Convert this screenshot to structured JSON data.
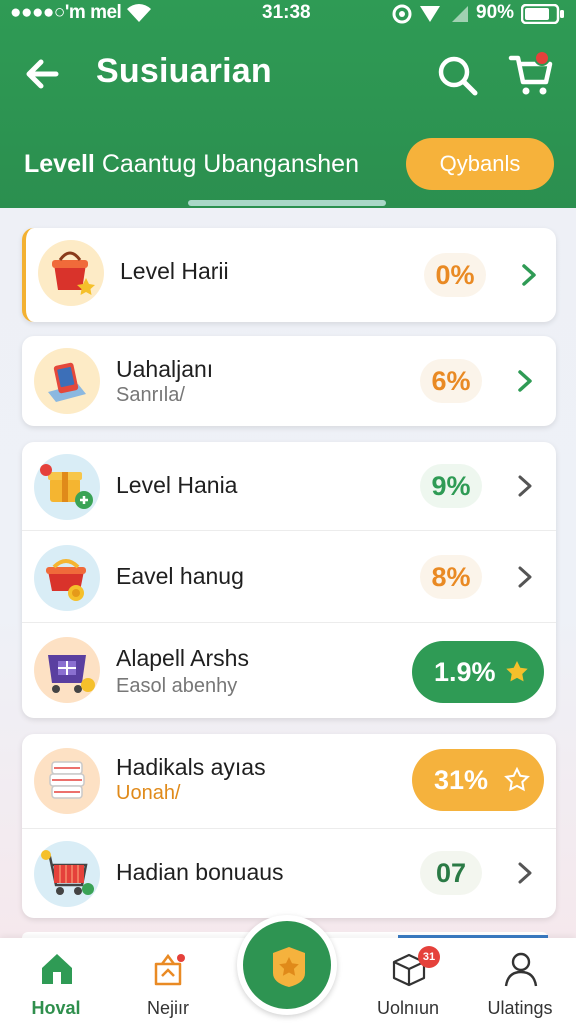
{
  "status_bar": {
    "carrier": "●●●●○'m mel",
    "time": "31:38",
    "battery": "90%"
  },
  "header": {
    "title": "Susiuarian",
    "subtitle_bold": "Levell",
    "subtitle_rest": "Caantug Ubanganshen",
    "action_button": "Qybanls"
  },
  "colors": {
    "brand_green": "#2f9b55",
    "accent_amber": "#f5b23d",
    "badge_orange": "#e98a24",
    "notification_red": "#e5413b"
  },
  "cards": [
    {
      "rows": [
        {
          "icon": "gift-basket-star-icon",
          "title": "Level Harii",
          "subtitle": "",
          "badge": "0%",
          "badge_style": "orange"
        }
      ]
    },
    {
      "rows": [
        {
          "icon": "tablet-book-icon",
          "title": "Uahaljanı",
          "subtitle": "Sanrıla/",
          "badge": "6%",
          "badge_style": "orange"
        }
      ]
    },
    {
      "rows": [
        {
          "icon": "gift-box-coin-icon",
          "title": "Level Hania",
          "subtitle": "",
          "badge": "9%",
          "badge_style": "green"
        },
        {
          "icon": "red-basket-coin-icon",
          "title": "Eavel hanug",
          "subtitle": "",
          "badge": "8%",
          "badge_style": "orange"
        },
        {
          "icon": "purple-gift-cart-icon",
          "title": "Alapell Arshs",
          "subtitle": "Easol abenhy",
          "badge": "1.9%",
          "badge_style": "green-pill"
        }
      ]
    },
    {
      "rows": [
        {
          "icon": "stacked-boxes-icon",
          "title": "Hadikals ayıas",
          "subtitle": "Uonah/",
          "badge": "31%",
          "badge_style": "amber-pill"
        },
        {
          "icon": "shopping-cart-icon",
          "title": "Hadian bonuaus",
          "subtitle": "",
          "badge": "07",
          "badge_style": "dark"
        }
      ]
    }
  ],
  "bottom_nav": {
    "items": [
      {
        "label": "Hoval",
        "icon": "home-icon",
        "active": true
      },
      {
        "label": "Nejiır",
        "icon": "tag-bag-icon",
        "active": false
      },
      {
        "label": "Uolnıun",
        "icon": "box-icon",
        "active": false,
        "badge": "31"
      },
      {
        "label": "Ulatings",
        "icon": "person-icon",
        "active": false
      }
    ],
    "center_button_icon": "shield-star-icon"
  }
}
